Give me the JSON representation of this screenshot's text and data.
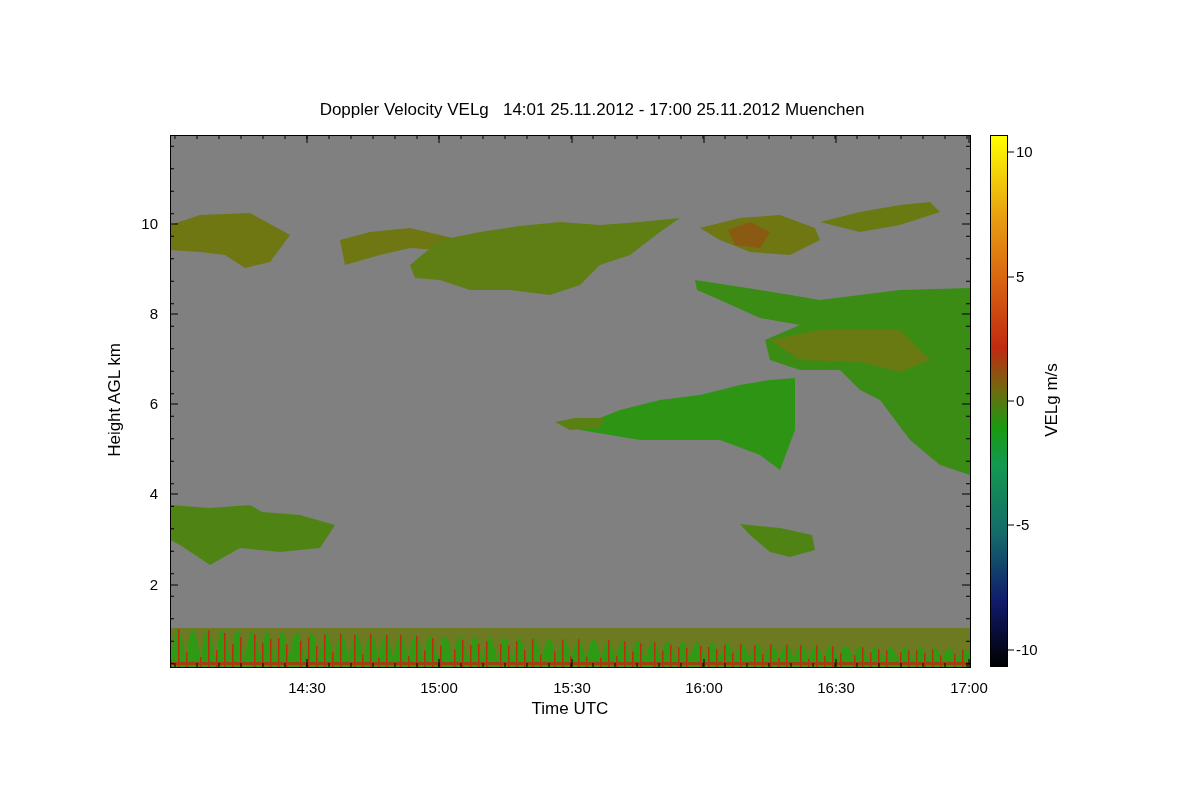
{
  "plot": {
    "title": "Doppler Velocity VELg   14:01 25.11.2012 - 17:00 25.11.2012 Muenchen",
    "y_axis": {
      "label": "Height AGL km",
      "ticks": [
        "10",
        "8",
        "6",
        "4",
        "2"
      ]
    },
    "x_axis": {
      "label": "Time UTC",
      "ticks": [
        "14:30",
        "15:00",
        "15:30",
        "16:00",
        "16:30",
        "17:00"
      ]
    },
    "colorbar": {
      "label": "VELg m/s",
      "ticks": [
        "10",
        "5",
        "0",
        "-5",
        "-10"
      ]
    }
  }
}
